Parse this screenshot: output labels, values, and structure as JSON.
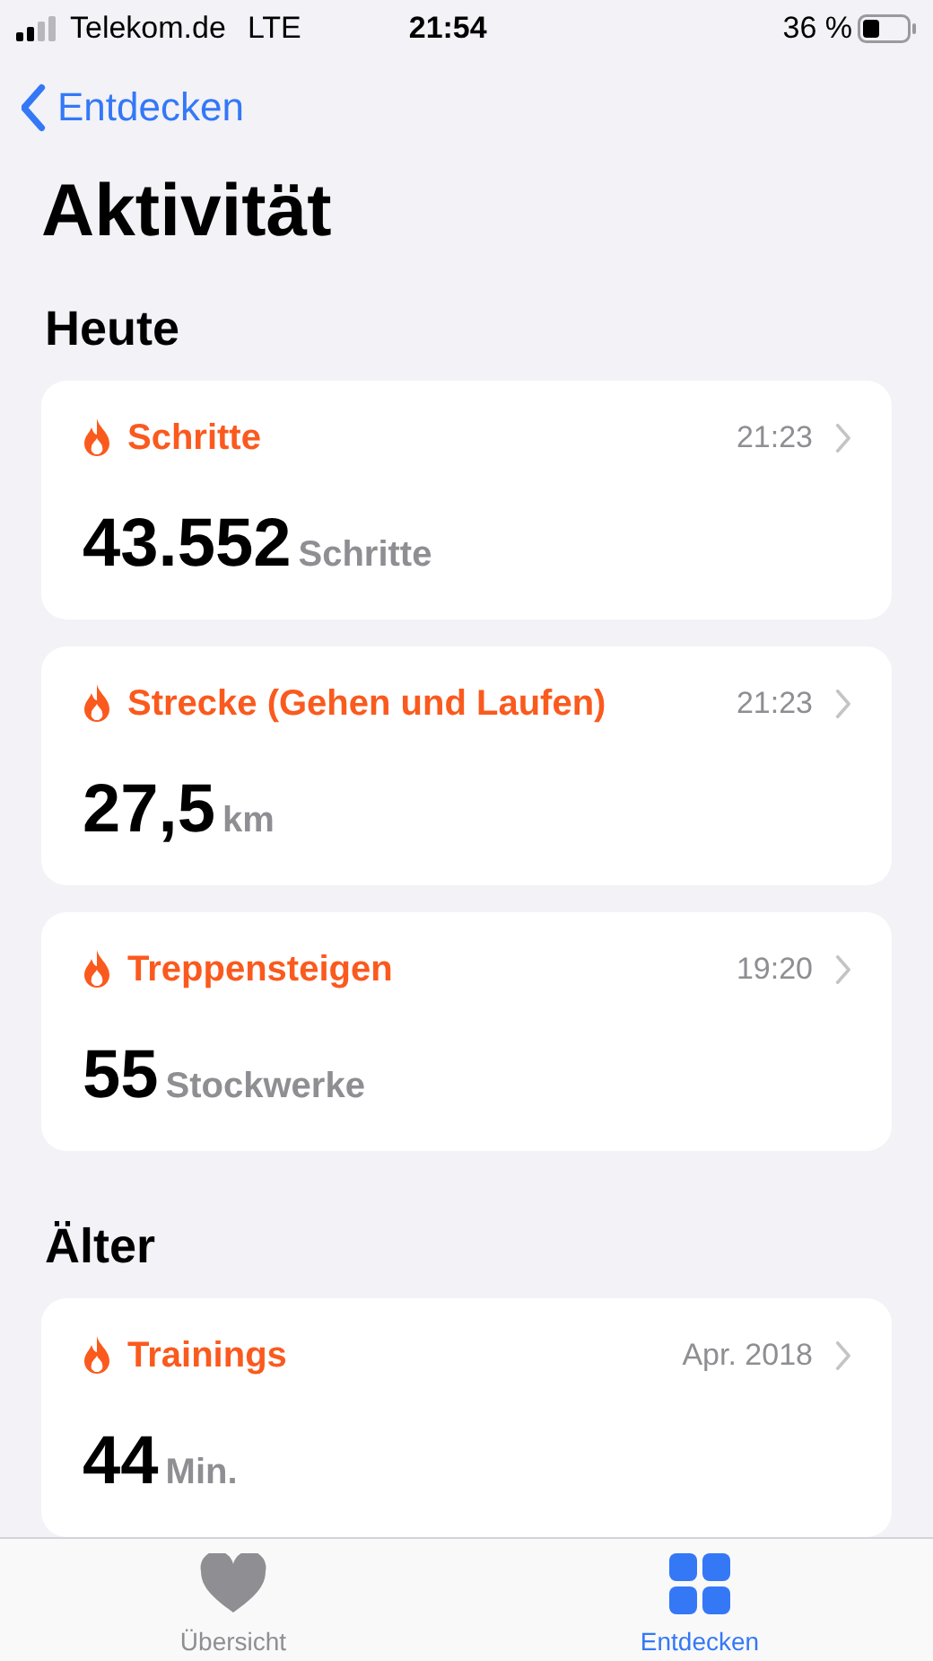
{
  "status_bar": {
    "carrier": "Telekom.de",
    "network": "LTE",
    "time": "21:54",
    "battery": "36 %"
  },
  "nav": {
    "back": "Entdecken"
  },
  "title": "Aktivität",
  "sections": [
    {
      "heading": "Heute",
      "cards": [
        {
          "title": "Schritte",
          "time": "21:23",
          "value": "43.552",
          "unit": "Schritte"
        },
        {
          "title": "Strecke (Gehen und Laufen)",
          "time": "21:23",
          "value": "27,5",
          "unit": "km"
        },
        {
          "title": "Treppensteigen",
          "time": "19:20",
          "value": "55",
          "unit": "Stockwerke"
        }
      ]
    },
    {
      "heading": "Älter",
      "cards": [
        {
          "title": "Trainings",
          "time": "Apr. 2018",
          "value": "44",
          "unit": "Min."
        }
      ]
    }
  ],
  "tab_bar": [
    {
      "kind": "heart",
      "label": "Übersicht",
      "selected": false
    },
    {
      "kind": "grid",
      "label": "Entdecken",
      "selected": true
    }
  ]
}
